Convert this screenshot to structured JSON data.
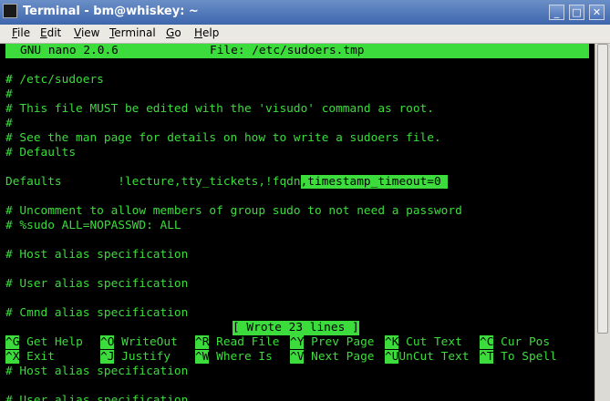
{
  "window": {
    "title": "Terminal - bm@whiskey: ~",
    "min": "_",
    "max": "□",
    "close": "✕"
  },
  "menu": [
    {
      "pre": "",
      "u": "F",
      "post": "ile"
    },
    {
      "pre": "",
      "u": "E",
      "post": "dit"
    },
    {
      "pre": "",
      "u": "V",
      "post": "iew"
    },
    {
      "pre": "",
      "u": "T",
      "post": "erminal"
    },
    {
      "pre": "",
      "u": "G",
      "post": "o"
    },
    {
      "pre": "",
      "u": "H",
      "post": "elp"
    }
  ],
  "nano": {
    "version": "GNU nano 2.0.6",
    "file": "File: /etc/sudoers.tmp",
    "lines": [
      "#",
      "# /etc/sudoers",
      "#",
      "# This file MUST be edited with the 'visudo' command as root.",
      "#",
      "# See the man page for details on how to write a sudoers file.",
      "# Defaults",
      "",
      "",
      "",
      "# Uncomment to allow members of group sudo to not need a password",
      "# %sudo ALL=NOPASSWD: ALL",
      "",
      "# Host alias specification",
      "",
      "# User alias specification",
      "",
      "",
      "# Cmnd alias specification"
    ],
    "defaults_line": {
      "plain": "Defaults        !lecture,tty_tickets,!fqdn",
      "highlight": ",timestamp_timeout=0 "
    },
    "status": "[ Wrote 23 lines ]",
    "shortcuts_row1": [
      {
        "key": "^G",
        "label": "Get Help"
      },
      {
        "key": "^O",
        "label": "WriteOut"
      },
      {
        "key": "^R",
        "label": "Read File"
      },
      {
        "key": "^Y",
        "label": "Prev Page"
      },
      {
        "key": "^K",
        "label": "Cut Text"
      },
      {
        "key": "^C",
        "label": "Cur Pos"
      }
    ],
    "shortcuts_row2": [
      {
        "key": "^X",
        "label": "Exit"
      },
      {
        "key": "^J",
        "label": "Justify"
      },
      {
        "key": "^W",
        "label": "Where Is"
      },
      {
        "key": "^V",
        "label": "Next Page"
      },
      {
        "key": "^U",
        "label": "UnCut Text"
      },
      {
        "key": "^T",
        "label": "To Spell"
      }
    ],
    "below": [
      "# Host alias specification",
      "",
      "# User alias specification"
    ]
  }
}
